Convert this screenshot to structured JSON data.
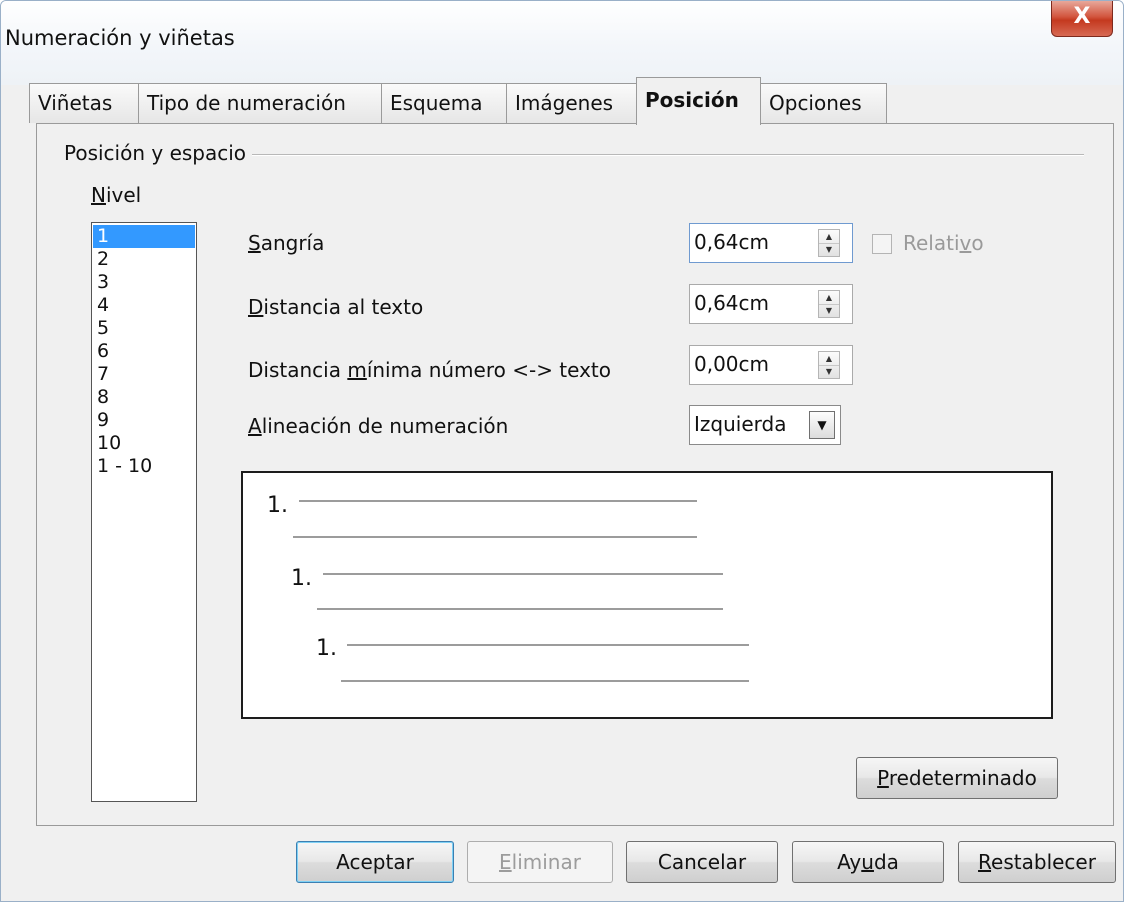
{
  "window": {
    "title": "Numeración y viñetas",
    "close_glyph": "X"
  },
  "tabs": [
    {
      "label": "Viñetas"
    },
    {
      "label": "Tipo de numeración"
    },
    {
      "label": "Esquema"
    },
    {
      "label": "Imágenes"
    },
    {
      "label": "Posición",
      "active": true
    },
    {
      "label": "Opciones"
    }
  ],
  "group": {
    "label": "Posición y espacio"
  },
  "level": {
    "label_mn": "N",
    "label_rest": "ivel",
    "items": [
      "1",
      "2",
      "3",
      "4",
      "5",
      "6",
      "7",
      "8",
      "9",
      "10",
      "1 - 10"
    ],
    "selected": "1"
  },
  "fields": {
    "indent": {
      "label_mn": "S",
      "label_rest": "angría",
      "value": "0,64cm"
    },
    "relative": {
      "label_pre": "Relati",
      "label_mn": "v",
      "label_post": "o",
      "checked": false
    },
    "distance_text": {
      "label_mn": "D",
      "label_rest": "istancia al texto",
      "value": "0,64cm"
    },
    "min_distance": {
      "label_pre": "Distancia ",
      "label_mn": "m",
      "label_post": "ínima número <-> texto",
      "value": "0,00cm"
    },
    "alignment": {
      "label_mn": "A",
      "label_rest": "lineación de numeración",
      "value": "Izquierda"
    }
  },
  "preview": {
    "numbers": [
      "1.",
      "1.",
      "1."
    ]
  },
  "buttons": {
    "default": {
      "label_mn": "P",
      "label_rest": "redeterminado"
    },
    "ok": {
      "label": "Aceptar"
    },
    "delete": {
      "label_mn": "E",
      "label_rest": "liminar"
    },
    "cancel": {
      "label": "Cancelar"
    },
    "help": {
      "label_pre": "Ay",
      "label_mn": "u",
      "label_post": "da"
    },
    "reset": {
      "label_mn": "R",
      "label_rest": "establecer"
    }
  },
  "colors": {
    "selection": "#3399ff",
    "close": "#c4391f"
  }
}
